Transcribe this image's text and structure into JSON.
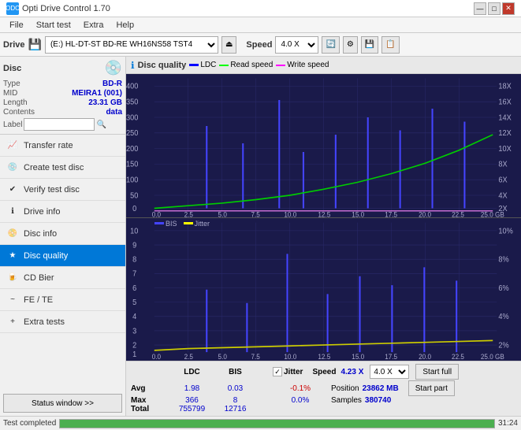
{
  "app": {
    "title": "Opti Drive Control 1.70",
    "icon": "ODC"
  },
  "title_controls": {
    "minimize": "—",
    "maximize": "□",
    "close": "✕"
  },
  "menu": {
    "items": [
      "File",
      "Start test",
      "Extra",
      "Help"
    ]
  },
  "toolbar": {
    "drive_label": "Drive",
    "drive_value": "(E:)  HL-DT-ST BD-RE  WH16NS58 TST4",
    "speed_label": "Speed",
    "speed_value": "4.0 X"
  },
  "disc": {
    "section_label": "Disc",
    "type_label": "Type",
    "type_value": "BD-R",
    "mid_label": "MID",
    "mid_value": "MEIRA1 (001)",
    "length_label": "Length",
    "length_value": "23.31 GB",
    "contents_label": "Contents",
    "contents_value": "data",
    "label_label": "Label"
  },
  "nav": {
    "items": [
      {
        "id": "transfer-rate",
        "label": "Transfer rate",
        "icon": "📈"
      },
      {
        "id": "create-test-disc",
        "label": "Create test disc",
        "icon": "💿"
      },
      {
        "id": "verify-test-disc",
        "label": "Verify test disc",
        "icon": "✔"
      },
      {
        "id": "drive-info",
        "label": "Drive info",
        "icon": "ℹ"
      },
      {
        "id": "disc-info",
        "label": "Disc info",
        "icon": "📀"
      },
      {
        "id": "disc-quality",
        "label": "Disc quality",
        "icon": "★",
        "active": true
      },
      {
        "id": "cd-bier",
        "label": "CD Bier",
        "icon": "🍺"
      },
      {
        "id": "fe-te",
        "label": "FE / TE",
        "icon": "~"
      },
      {
        "id": "extra-tests",
        "label": "Extra tests",
        "icon": "+"
      }
    ]
  },
  "status_window_btn": "Status window >>",
  "chart": {
    "title": "Disc quality",
    "legend": [
      {
        "label": "LDC",
        "color": "#0000ff"
      },
      {
        "label": "Read speed",
        "color": "#00ff00"
      },
      {
        "label": "Write speed",
        "color": "#ff00ff"
      }
    ],
    "legend2": [
      {
        "label": "BIS",
        "color": "#0000ff"
      },
      {
        "label": "Jitter",
        "color": "#ffff00"
      }
    ],
    "top_y_axis": [
      "400",
      "350",
      "300",
      "250",
      "200",
      "150",
      "100",
      "50",
      "0"
    ],
    "top_y_right": [
      "18X",
      "16X",
      "14X",
      "12X",
      "10X",
      "8X",
      "6X",
      "4X",
      "2X"
    ],
    "bottom_y_axis": [
      "10",
      "9",
      "8",
      "7",
      "6",
      "5",
      "4",
      "3",
      "2",
      "1"
    ],
    "bottom_y_right": [
      "10%",
      "8%",
      "6%",
      "4%",
      "2%"
    ],
    "x_axis": [
      "0.0",
      "2.5",
      "5.0",
      "7.5",
      "10.0",
      "12.5",
      "15.0",
      "17.5",
      "20.0",
      "22.5",
      "25.0 GB"
    ]
  },
  "stats": {
    "ldc_label": "LDC",
    "bis_label": "BIS",
    "jitter_label": "Jitter",
    "speed_label": "Speed",
    "avg_label": "Avg",
    "max_label": "Max",
    "total_label": "Total",
    "ldc_avg": "1.98",
    "ldc_max": "366",
    "ldc_total": "755799",
    "bis_avg": "0.03",
    "bis_max": "8",
    "bis_total": "12716",
    "jitter_avg": "-0.1%",
    "jitter_max": "0.0%",
    "speed_val": "4.23 X",
    "speed_select": "4.0 X",
    "position_label": "Position",
    "position_val": "23862 MB",
    "samples_label": "Samples",
    "samples_val": "380740",
    "btn_full": "Start full",
    "btn_part": "Start part"
  },
  "status_bar": {
    "text": "Test completed",
    "progress": 100,
    "time": "31:24"
  }
}
